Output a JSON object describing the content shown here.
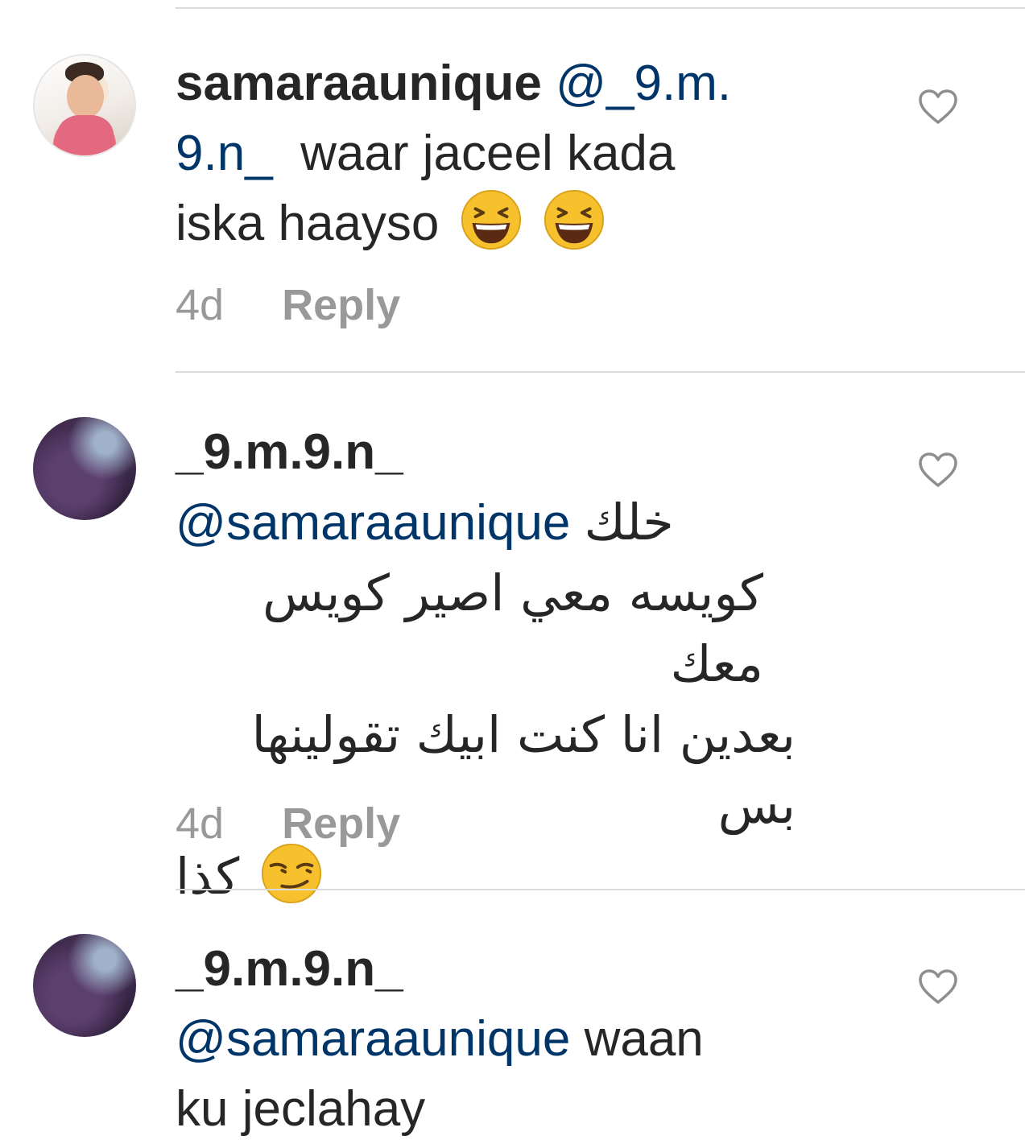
{
  "comments": [
    {
      "username": "samaraaunique",
      "mention_line1": "@_9.m.",
      "mention_line2": "9.n_",
      "text_line2": "  waar jaceel kada",
      "text_line3": "iska haayso",
      "emoji": [
        "laughing-squint-emoji",
        "laughing-squint-emoji"
      ],
      "time": "4d",
      "reply": "Reply"
    },
    {
      "username": "_9.m.9.n_",
      "mention": "@samaraaunique",
      "arabic_line1": "خلك",
      "arabic_line2": "كويسه معي اصير كويس معك",
      "arabic_line3": "بعدين انا كنت ابيك تقولينها بس",
      "arabic_line4": "كذا",
      "emoji": [
        "smirk-emoji"
      ],
      "time": "4d",
      "reply": "Reply"
    },
    {
      "username": "_9.m.9.n_",
      "mention": "@samaraaunique",
      "text_line1": " waan",
      "text_line2": "ku jeclahay"
    }
  ],
  "colors": {
    "mention": "#003569",
    "text": "#262626",
    "meta": "#999999",
    "divider": "#dbdbdb"
  }
}
